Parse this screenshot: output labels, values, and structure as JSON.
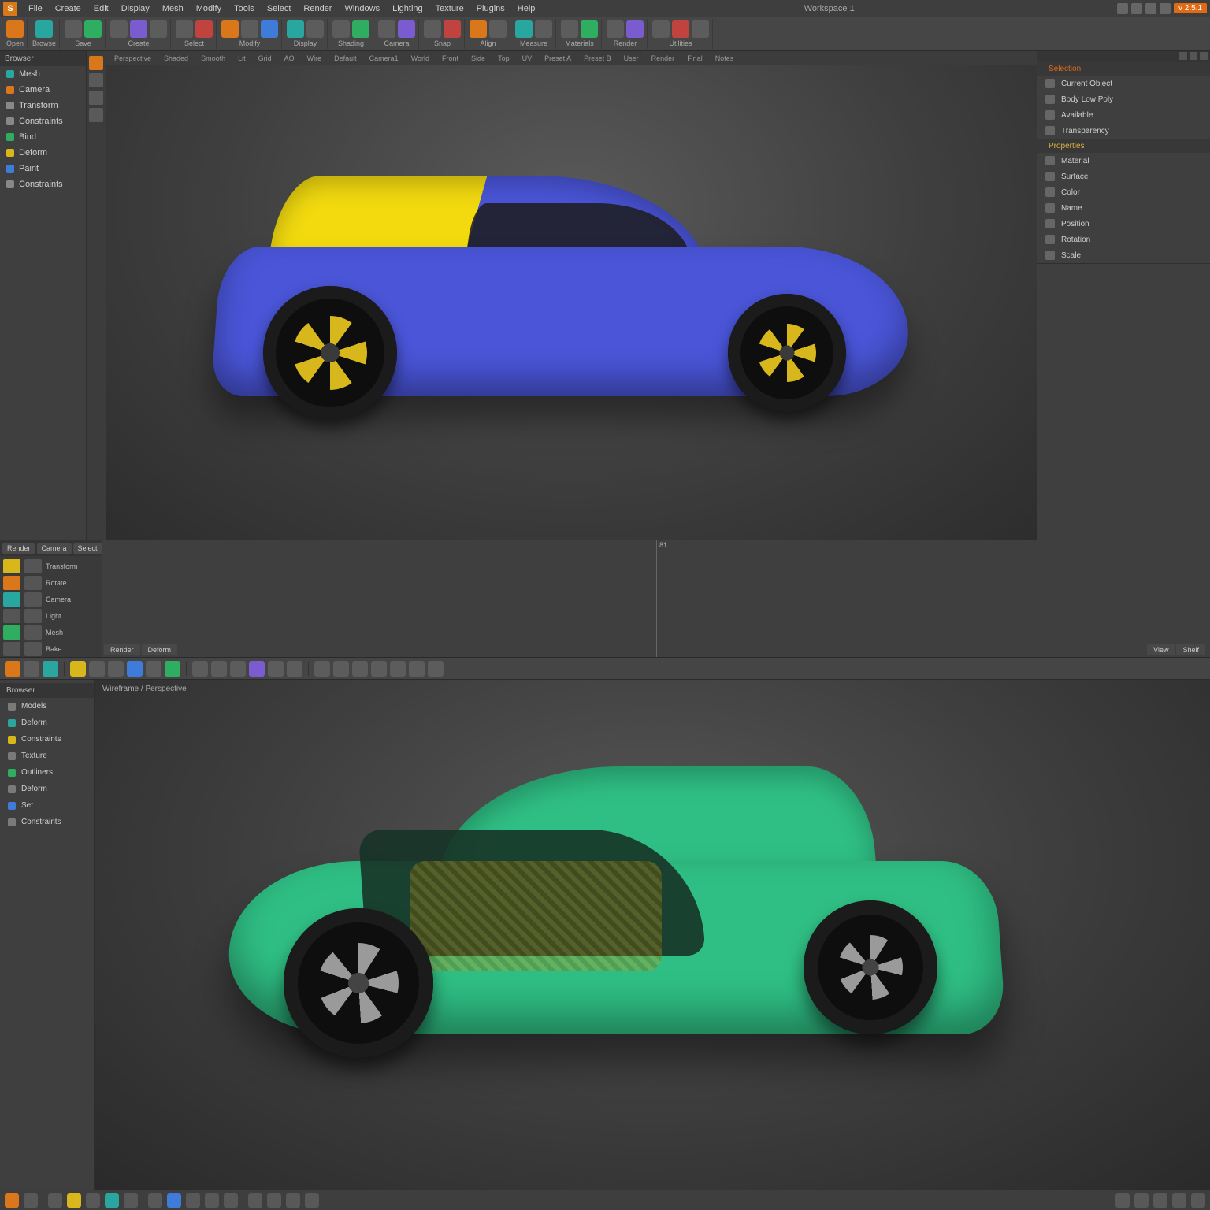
{
  "app": {
    "icon_letter": "S",
    "title": "Workspace 1",
    "version_badge": "v 2.5.1"
  },
  "menubar": [
    "File",
    "Create",
    "Edit",
    "Display",
    "Mesh",
    "Modify",
    "Tools",
    "Select",
    "Render",
    "Windows",
    "Lighting",
    "Texture",
    "Plugins",
    "Help"
  ],
  "ribbon_groups": [
    {
      "label": "Open",
      "count": 1
    },
    {
      "label": "Browse",
      "count": 1
    },
    {
      "label": "Save",
      "count": 2
    },
    {
      "label": "Create",
      "count": 3
    },
    {
      "label": "Select",
      "count": 2
    },
    {
      "label": "Modify",
      "count": 3
    },
    {
      "label": "Display",
      "count": 2
    },
    {
      "label": "Shading",
      "count": 2
    },
    {
      "label": "Camera",
      "count": 2
    },
    {
      "label": "Snap",
      "count": 2
    },
    {
      "label": "Align",
      "count": 2
    },
    {
      "label": "Measure",
      "count": 2
    },
    {
      "label": "Materials",
      "count": 2
    },
    {
      "label": "Render",
      "count": 2
    },
    {
      "label": "Utilities",
      "count": 3
    }
  ],
  "left_nav": {
    "header": "Browser",
    "items": [
      "Mesh",
      "Camera",
      "Transform",
      "Constraints",
      "Bind",
      "Deform",
      "Paint",
      "Constraints"
    ]
  },
  "vp_tabs": [
    "Perspective",
    "Shaded",
    "Smooth",
    "Lit",
    "Grid",
    "AO",
    "Wire",
    "Default",
    "Camera1",
    "World",
    "Front",
    "Side",
    "Top",
    "UV",
    "Preset A",
    "Preset B",
    "User",
    "Render",
    "Final",
    "Notes"
  ],
  "right_panel": {
    "section1": "Selection",
    "props1": [
      "Current Object",
      "Body Low Poly",
      "Available",
      "Transparency"
    ],
    "section2": "Properties",
    "props2": [
      "Material",
      "Surface",
      "Color",
      "Name",
      "Position",
      "Rotation",
      "Scale"
    ]
  },
  "mid": {
    "tabs": [
      "Render",
      "Camera",
      "Select"
    ],
    "rows": [
      "Transform",
      "Rotate",
      "Camera",
      "Light",
      "Mesh",
      "Bake"
    ],
    "timeline_marker": "81",
    "bottom_tabs": [
      "Render",
      "Deform"
    ],
    "right_tabs": [
      "View",
      "Shelf"
    ]
  },
  "toolbar2_count": 22,
  "left_nav2": {
    "header": "Browser",
    "items": [
      "Models",
      "Deform",
      "Constraints",
      "Texture",
      "Outliners",
      "Deform",
      "Set",
      "Constraints"
    ]
  },
  "view2_label": "Wireframe / Perspective",
  "statusbar": {
    "icon_count": 16,
    "right_icon_count": 5
  }
}
